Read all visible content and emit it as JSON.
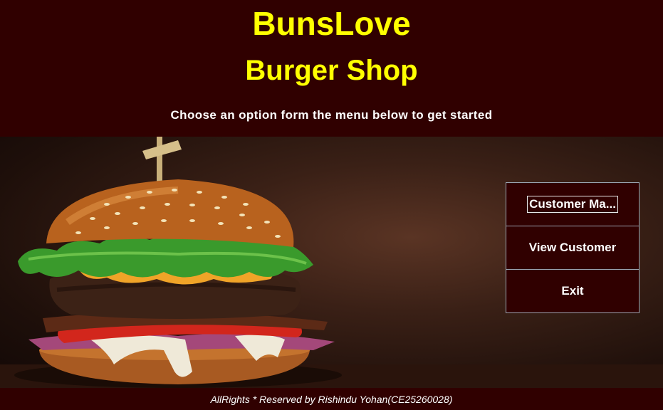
{
  "header": {
    "title": "BunsLove",
    "subtitle": "Burger Shop",
    "instruction": "Choose an option form the menu below to get started"
  },
  "hero": {
    "image": "burger-image"
  },
  "menu": {
    "items": [
      {
        "label": "Customer Ma..."
      },
      {
        "label": "View Customer"
      },
      {
        "label": "Exit"
      }
    ]
  },
  "footer": {
    "text": "AllRights * Reserved by Rishindu Yohan(CE25260028)"
  },
  "colors": {
    "background": "#300000",
    "title": "#ffff00",
    "text": "#ffffff",
    "button_border": "#9aa4b0"
  }
}
